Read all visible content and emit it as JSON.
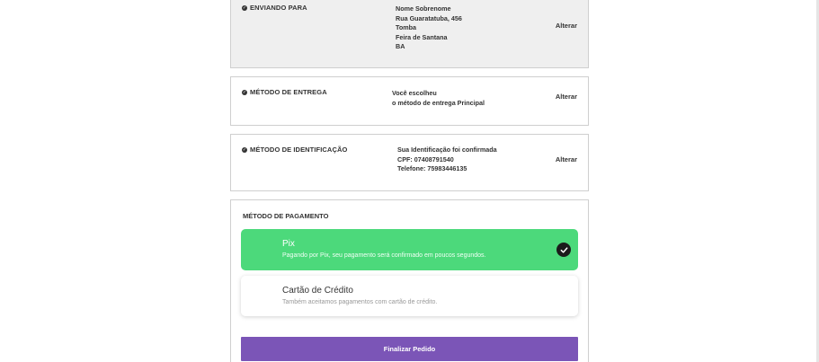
{
  "shipping": {
    "title": "ENVIANDO PARA",
    "lines": [
      "Nome Sobrenome",
      "Rua Guaratatuba, 456",
      "Tomba",
      "Feira de Santana",
      "BA"
    ],
    "change_label": "Alterar"
  },
  "delivery": {
    "title": "MÉTODO DE ENTREGA",
    "lines": [
      "Você escolheu",
      "o método de entrega Principal"
    ],
    "change_label": "Alterar"
  },
  "identification": {
    "title": "MÉTODO DE IDENTIFICAÇÃO",
    "lines": [
      "Sua Identificação foi confirmada",
      "CPF: 07408791540",
      "Telefone: 75983446135"
    ],
    "change_label": "Alterar"
  },
  "payment": {
    "title": "MÉTODO DE PAGAMENTO",
    "options": [
      {
        "name": "Pix",
        "description": "Pagando por Pix, seu pagamento será confirmado em poucos segundos.",
        "selected": true
      },
      {
        "name": "Cartão de Crédito",
        "description": "Também aceitamos pagamentos com cartão de crédito.",
        "selected": false
      }
    ],
    "submit_label": "Finalizar Pedido"
  },
  "colors": {
    "selected_option": "#4cd97b",
    "submit_button": "#7b55b7"
  }
}
